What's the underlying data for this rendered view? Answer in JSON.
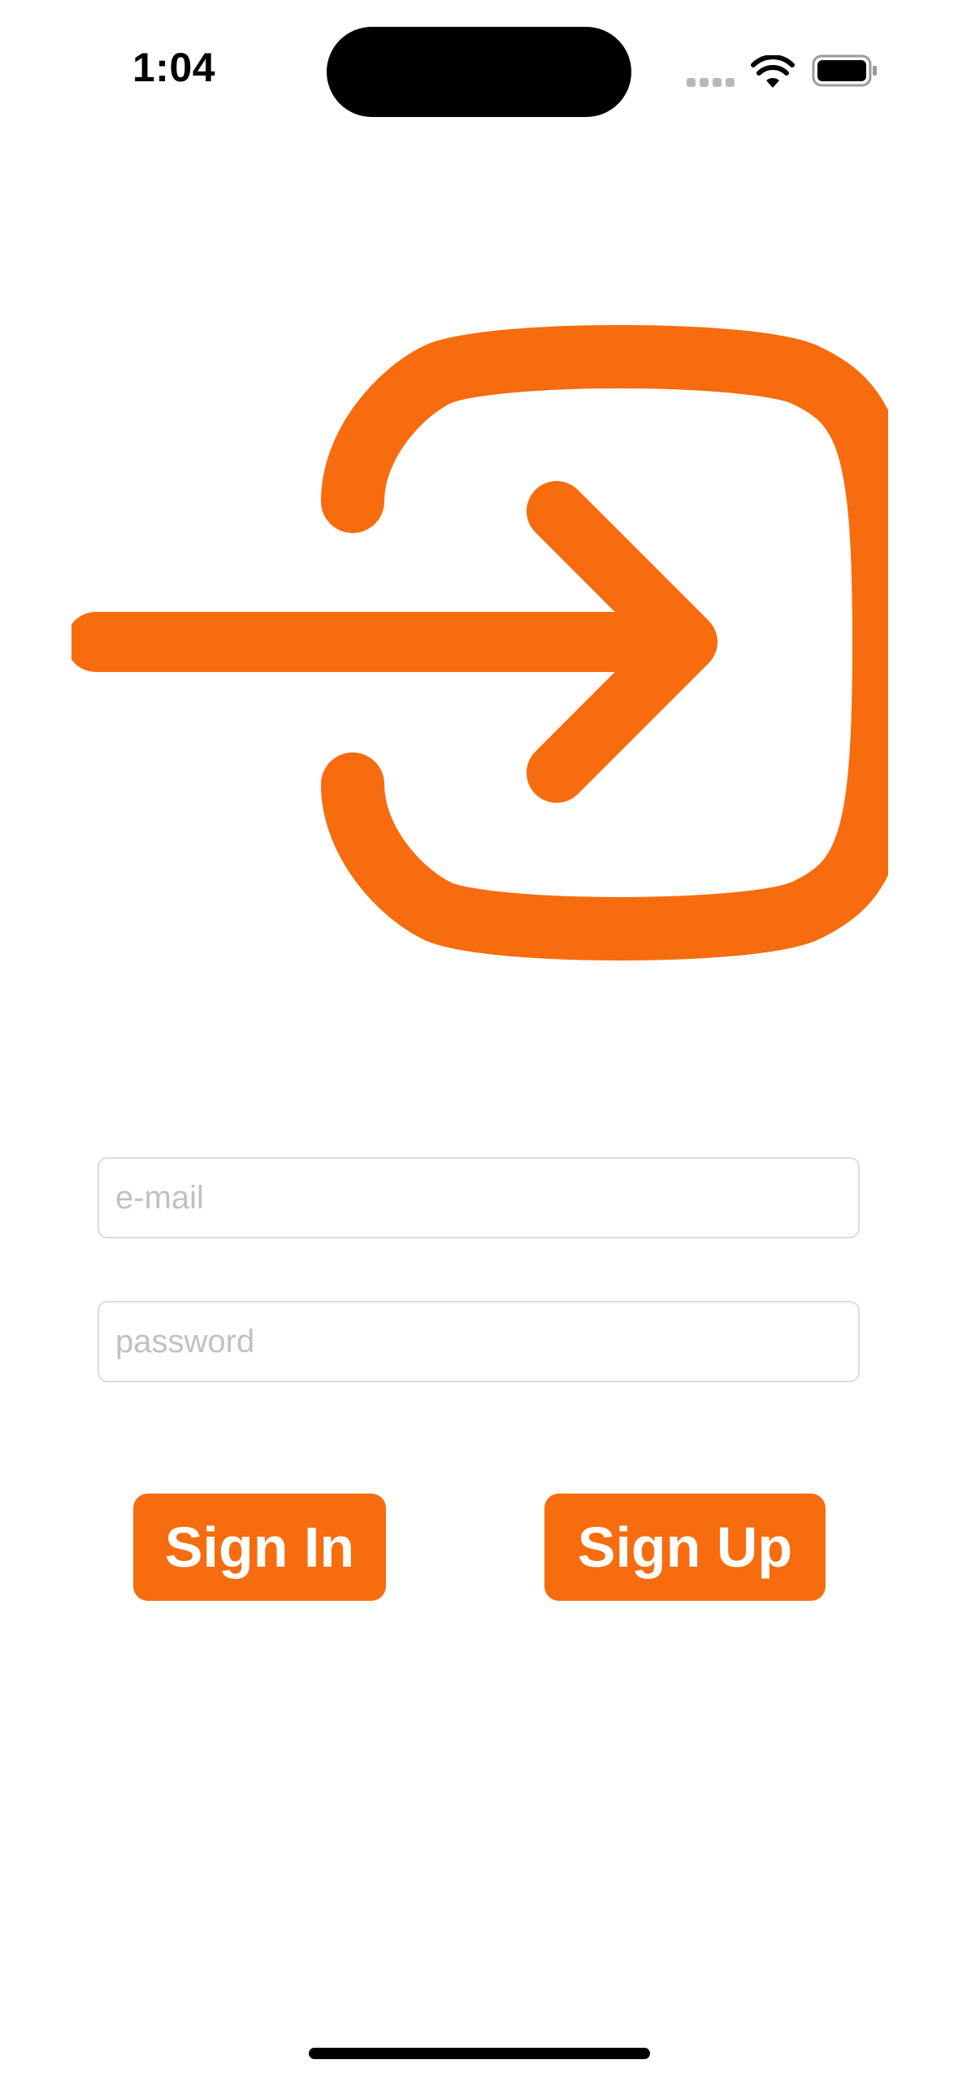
{
  "status_bar": {
    "time": "1:04"
  },
  "login_form": {
    "email_placeholder": "e-mail",
    "password_placeholder": "password"
  },
  "actions": {
    "sign_in_label": "Sign In",
    "sign_up_label": "Sign Up"
  },
  "icons": {
    "hero": "sign-in-arrow-icon",
    "wifi": "wifi-icon",
    "battery": "battery-icon",
    "signal": "cellular-signal-icon"
  },
  "colors": {
    "accent": "#f76c0e",
    "background": "#ffffff",
    "field_border": "#dcdcdc",
    "placeholder": "#c1c1c1"
  }
}
